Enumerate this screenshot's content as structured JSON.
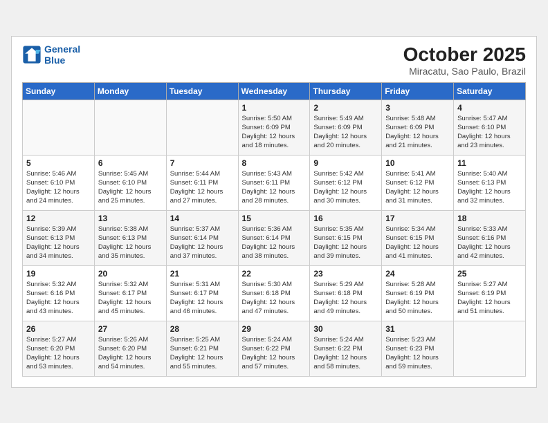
{
  "header": {
    "logo_line1": "General",
    "logo_line2": "Blue",
    "month": "October 2025",
    "location": "Miracatu, Sao Paulo, Brazil"
  },
  "weekdays": [
    "Sunday",
    "Monday",
    "Tuesday",
    "Wednesday",
    "Thursday",
    "Friday",
    "Saturday"
  ],
  "weeks": [
    [
      {
        "day": "",
        "info": ""
      },
      {
        "day": "",
        "info": ""
      },
      {
        "day": "",
        "info": ""
      },
      {
        "day": "1",
        "info": "Sunrise: 5:50 AM\nSunset: 6:09 PM\nDaylight: 12 hours\nand 18 minutes."
      },
      {
        "day": "2",
        "info": "Sunrise: 5:49 AM\nSunset: 6:09 PM\nDaylight: 12 hours\nand 20 minutes."
      },
      {
        "day": "3",
        "info": "Sunrise: 5:48 AM\nSunset: 6:09 PM\nDaylight: 12 hours\nand 21 minutes."
      },
      {
        "day": "4",
        "info": "Sunrise: 5:47 AM\nSunset: 6:10 PM\nDaylight: 12 hours\nand 23 minutes."
      }
    ],
    [
      {
        "day": "5",
        "info": "Sunrise: 5:46 AM\nSunset: 6:10 PM\nDaylight: 12 hours\nand 24 minutes."
      },
      {
        "day": "6",
        "info": "Sunrise: 5:45 AM\nSunset: 6:10 PM\nDaylight: 12 hours\nand 25 minutes."
      },
      {
        "day": "7",
        "info": "Sunrise: 5:44 AM\nSunset: 6:11 PM\nDaylight: 12 hours\nand 27 minutes."
      },
      {
        "day": "8",
        "info": "Sunrise: 5:43 AM\nSunset: 6:11 PM\nDaylight: 12 hours\nand 28 minutes."
      },
      {
        "day": "9",
        "info": "Sunrise: 5:42 AM\nSunset: 6:12 PM\nDaylight: 12 hours\nand 30 minutes."
      },
      {
        "day": "10",
        "info": "Sunrise: 5:41 AM\nSunset: 6:12 PM\nDaylight: 12 hours\nand 31 minutes."
      },
      {
        "day": "11",
        "info": "Sunrise: 5:40 AM\nSunset: 6:13 PM\nDaylight: 12 hours\nand 32 minutes."
      }
    ],
    [
      {
        "day": "12",
        "info": "Sunrise: 5:39 AM\nSunset: 6:13 PM\nDaylight: 12 hours\nand 34 minutes."
      },
      {
        "day": "13",
        "info": "Sunrise: 5:38 AM\nSunset: 6:13 PM\nDaylight: 12 hours\nand 35 minutes."
      },
      {
        "day": "14",
        "info": "Sunrise: 5:37 AM\nSunset: 6:14 PM\nDaylight: 12 hours\nand 37 minutes."
      },
      {
        "day": "15",
        "info": "Sunrise: 5:36 AM\nSunset: 6:14 PM\nDaylight: 12 hours\nand 38 minutes."
      },
      {
        "day": "16",
        "info": "Sunrise: 5:35 AM\nSunset: 6:15 PM\nDaylight: 12 hours\nand 39 minutes."
      },
      {
        "day": "17",
        "info": "Sunrise: 5:34 AM\nSunset: 6:15 PM\nDaylight: 12 hours\nand 41 minutes."
      },
      {
        "day": "18",
        "info": "Sunrise: 5:33 AM\nSunset: 6:16 PM\nDaylight: 12 hours\nand 42 minutes."
      }
    ],
    [
      {
        "day": "19",
        "info": "Sunrise: 5:32 AM\nSunset: 6:16 PM\nDaylight: 12 hours\nand 43 minutes."
      },
      {
        "day": "20",
        "info": "Sunrise: 5:32 AM\nSunset: 6:17 PM\nDaylight: 12 hours\nand 45 minutes."
      },
      {
        "day": "21",
        "info": "Sunrise: 5:31 AM\nSunset: 6:17 PM\nDaylight: 12 hours\nand 46 minutes."
      },
      {
        "day": "22",
        "info": "Sunrise: 5:30 AM\nSunset: 6:18 PM\nDaylight: 12 hours\nand 47 minutes."
      },
      {
        "day": "23",
        "info": "Sunrise: 5:29 AM\nSunset: 6:18 PM\nDaylight: 12 hours\nand 49 minutes."
      },
      {
        "day": "24",
        "info": "Sunrise: 5:28 AM\nSunset: 6:19 PM\nDaylight: 12 hours\nand 50 minutes."
      },
      {
        "day": "25",
        "info": "Sunrise: 5:27 AM\nSunset: 6:19 PM\nDaylight: 12 hours\nand 51 minutes."
      }
    ],
    [
      {
        "day": "26",
        "info": "Sunrise: 5:27 AM\nSunset: 6:20 PM\nDaylight: 12 hours\nand 53 minutes."
      },
      {
        "day": "27",
        "info": "Sunrise: 5:26 AM\nSunset: 6:20 PM\nDaylight: 12 hours\nand 54 minutes."
      },
      {
        "day": "28",
        "info": "Sunrise: 5:25 AM\nSunset: 6:21 PM\nDaylight: 12 hours\nand 55 minutes."
      },
      {
        "day": "29",
        "info": "Sunrise: 5:24 AM\nSunset: 6:22 PM\nDaylight: 12 hours\nand 57 minutes."
      },
      {
        "day": "30",
        "info": "Sunrise: 5:24 AM\nSunset: 6:22 PM\nDaylight: 12 hours\nand 58 minutes."
      },
      {
        "day": "31",
        "info": "Sunrise: 5:23 AM\nSunset: 6:23 PM\nDaylight: 12 hours\nand 59 minutes."
      },
      {
        "day": "",
        "info": ""
      }
    ]
  ]
}
